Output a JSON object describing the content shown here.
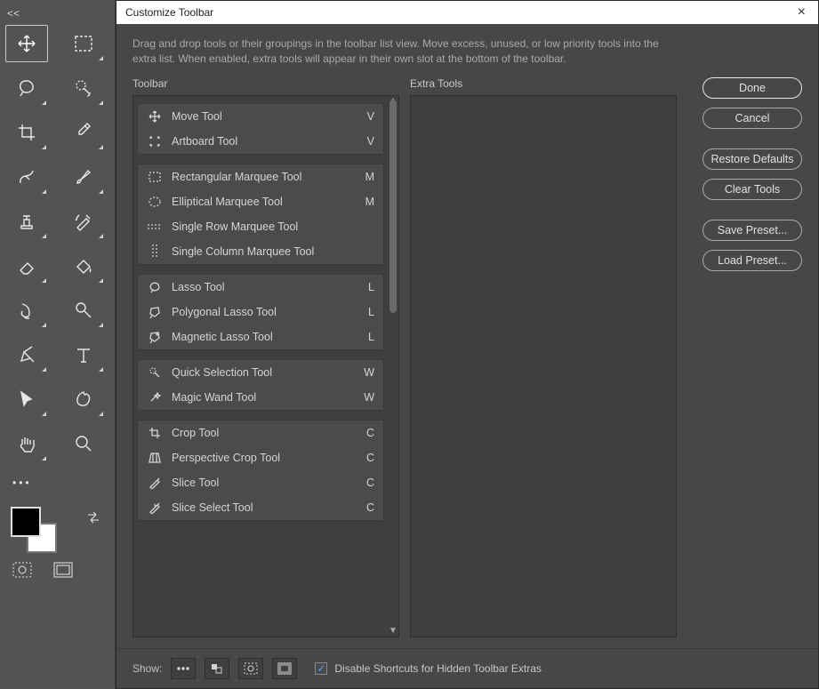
{
  "toolbar_panel": {
    "tools": [
      {
        "name": "move-tool",
        "has_submenu": false,
        "primary": true
      },
      {
        "name": "marquee-tool",
        "has_submenu": true
      },
      {
        "name": "lasso-tool",
        "has_submenu": true
      },
      {
        "name": "quick-select-tool",
        "has_submenu": true
      },
      {
        "name": "crop-tool",
        "has_submenu": true
      },
      {
        "name": "eyedropper-tool",
        "has_submenu": true
      },
      {
        "name": "healing-brush-tool",
        "has_submenu": true
      },
      {
        "name": "brush-tool",
        "has_submenu": true
      },
      {
        "name": "clone-stamp-tool",
        "has_submenu": true
      },
      {
        "name": "history-brush-tool",
        "has_submenu": true
      },
      {
        "name": "eraser-tool",
        "has_submenu": true
      },
      {
        "name": "paint-bucket-tool",
        "has_submenu": true
      },
      {
        "name": "smudge-tool",
        "has_submenu": true
      },
      {
        "name": "dodge-tool",
        "has_submenu": true
      },
      {
        "name": "pen-tool",
        "has_submenu": true
      },
      {
        "name": "type-tool",
        "has_submenu": true
      },
      {
        "name": "path-select-tool",
        "has_submenu": true
      },
      {
        "name": "shape-tool",
        "has_submenu": true
      },
      {
        "name": "hand-tool",
        "has_submenu": true
      },
      {
        "name": "zoom-tool",
        "has_submenu": false
      }
    ]
  },
  "dialog": {
    "title": "Customize Toolbar",
    "description": "Drag and drop tools or their groupings in the toolbar list view. Move excess, unused, or low priority tools into the extra list. When enabled, extra tools will appear in their own slot at the bottom of the toolbar.",
    "columns": {
      "toolbar_header": "Toolbar",
      "extra_header": "Extra Tools"
    },
    "buttons": {
      "done": "Done",
      "cancel": "Cancel",
      "restore": "Restore Defaults",
      "clear": "Clear Tools",
      "save": "Save Preset...",
      "load": "Load Preset..."
    },
    "footer": {
      "show_label": "Show:",
      "checkbox_label": "Disable Shortcuts for Hidden Toolbar Extras",
      "checkbox_checked": true
    },
    "tool_groups": [
      {
        "items": [
          {
            "icon": "move",
            "label": "Move Tool",
            "key": "V"
          },
          {
            "icon": "artboard",
            "label": "Artboard Tool",
            "key": "V"
          }
        ]
      },
      {
        "items": [
          {
            "icon": "rect-marquee",
            "label": "Rectangular Marquee Tool",
            "key": "M"
          },
          {
            "icon": "ellipse-marquee",
            "label": "Elliptical Marquee Tool",
            "key": "M"
          },
          {
            "icon": "row-marquee",
            "label": "Single Row Marquee Tool",
            "key": ""
          },
          {
            "icon": "col-marquee",
            "label": "Single Column Marquee Tool",
            "key": ""
          }
        ]
      },
      {
        "items": [
          {
            "icon": "lasso",
            "label": "Lasso Tool",
            "key": "L"
          },
          {
            "icon": "poly-lasso",
            "label": "Polygonal Lasso Tool",
            "key": "L"
          },
          {
            "icon": "mag-lasso",
            "label": "Magnetic Lasso Tool",
            "key": "L"
          }
        ]
      },
      {
        "items": [
          {
            "icon": "quick-select",
            "label": "Quick Selection Tool",
            "key": "W"
          },
          {
            "icon": "magic-wand",
            "label": "Magic Wand Tool",
            "key": "W"
          }
        ]
      },
      {
        "items": [
          {
            "icon": "crop",
            "label": "Crop Tool",
            "key": "C"
          },
          {
            "icon": "persp-crop",
            "label": "Perspective Crop Tool",
            "key": "C"
          },
          {
            "icon": "slice",
            "label": "Slice Tool",
            "key": "C"
          },
          {
            "icon": "slice-select",
            "label": "Slice Select Tool",
            "key": "C"
          }
        ]
      }
    ]
  }
}
